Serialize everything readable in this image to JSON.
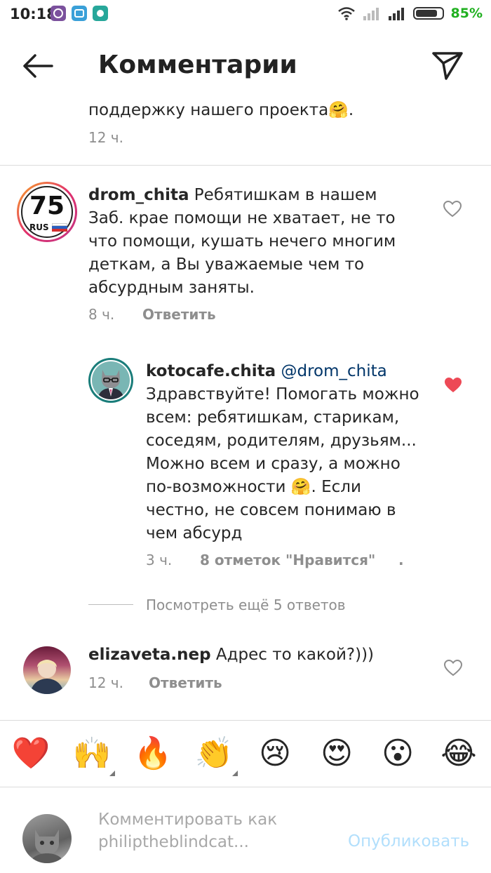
{
  "status_bar": {
    "time": "10:18",
    "battery_pct": "85%",
    "battery_level": 0.85,
    "apps": [
      {
        "icon": "viber-icon",
        "color": "#7b519d"
      },
      {
        "icon": "messaging-icon",
        "color": "#3aa0d8"
      },
      {
        "icon": "app-icon",
        "color": "#27a79a"
      }
    ]
  },
  "header": {
    "back_icon": "arrow-left-icon",
    "title": "Комментарии",
    "share_icon": "paper-plane-icon"
  },
  "comments": {
    "previous": {
      "text": "поддержку нашего проекта🤗.",
      "time": "12 ч."
    },
    "drom": {
      "username": "drom_chita",
      "text": " Ребятишкам в нашем Заб. крае помощи не хватает, не то что помощи, кушать нечего многим деткам, а Вы уважаемые чем то абсурдным заняты.",
      "time": "8 ч.",
      "reply_label": "Ответить",
      "avatar_number": "75",
      "avatar_region": "RUS",
      "liked": false
    },
    "kotocafe": {
      "username": "kotocafe.chita",
      "mention": " @drom_chita",
      "text": "Здравствуйте! Помогать можно всем: ребятишкам, старикам, соседям, родителям, друзьям... Можно всем и сразу, а можно по-возможности 🤗. Если честно, не совсем понимаю в чем абсурд",
      "time": "3 ч.",
      "likes_label": "8 отметок \"Нравится\"",
      "dot": ".",
      "liked": true
    },
    "view_more": "Посмотреть ещё 5 ответов",
    "elizaveta": {
      "username": "elizaveta.nep",
      "text": " Адрес то какой?)))",
      "time": "12 ч.",
      "reply_label": "Ответить",
      "liked": false
    }
  },
  "emoji_bar": [
    "❤️",
    "🙌",
    "🔥",
    "👏",
    "😢",
    "😍",
    "😮",
    "😂"
  ],
  "composer": {
    "placeholder": "Комментировать как philiptheblindcat...",
    "publish_label": "Опубликовать"
  },
  "colors": {
    "like_red": "#ed4956",
    "link_blue": "#003569",
    "publish_blue": "#b2dffc"
  }
}
